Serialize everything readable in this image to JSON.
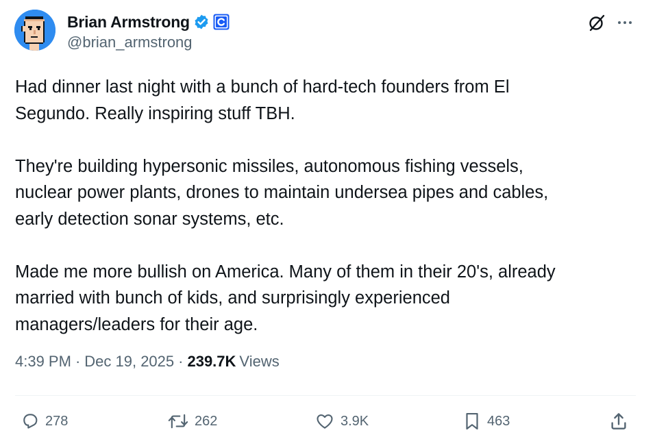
{
  "author": {
    "display_name": "Brian Armstrong",
    "handle": "@brian_armstrong",
    "verified_color": "#1d9bf0",
    "affiliate_badge": "coinbase-badge-icon",
    "affiliate_color": "#1a5cf5"
  },
  "tweet": {
    "paragraphs": [
      "Had dinner last night with a bunch of hard-tech founders from El Segundo. Really inspiring stuff TBH.",
      "They're building hypersonic missiles, autonomous fishing vessels, nuclear power plants, drones to maintain undersea pipes and cables, early detection sonar systems, etc.",
      "Made me more bullish on America. Many of them in their 20's, already married with bunch of kids, and surprisingly experienced managers/leaders for their age."
    ],
    "lines": [
      "Had dinner last night with a bunch of hard-tech founders from El",
      "Segundo. Really inspiring stuff TBH.",
      "They're building hypersonic missiles, autonomous fishing vessels,",
      "nuclear power plants, drones to maintain undersea pipes and cables,",
      "early detection sonar systems, etc.",
      "Made me more bullish on America. Many of them in their 20's, already",
      "married with bunch of kids, and surprisingly experienced",
      "managers/leaders for their age."
    ]
  },
  "meta": {
    "time": "4:39 PM",
    "separator": "·",
    "date": "Dec 19, 2025",
    "views_count": "239.7K",
    "views_label": "Views"
  },
  "actions": {
    "replies": "278",
    "reposts": "262",
    "likes": "3.9K",
    "bookmarks": "463"
  },
  "icons": {
    "grok": "grok-icon",
    "more": "more-icon",
    "reply": "reply-icon",
    "repost": "repost-icon",
    "like": "heart-icon",
    "bookmark": "bookmark-icon",
    "share": "share-icon"
  },
  "colors": {
    "text": "#0f1419",
    "secondary": "#536471",
    "divider": "#eff3f4"
  }
}
